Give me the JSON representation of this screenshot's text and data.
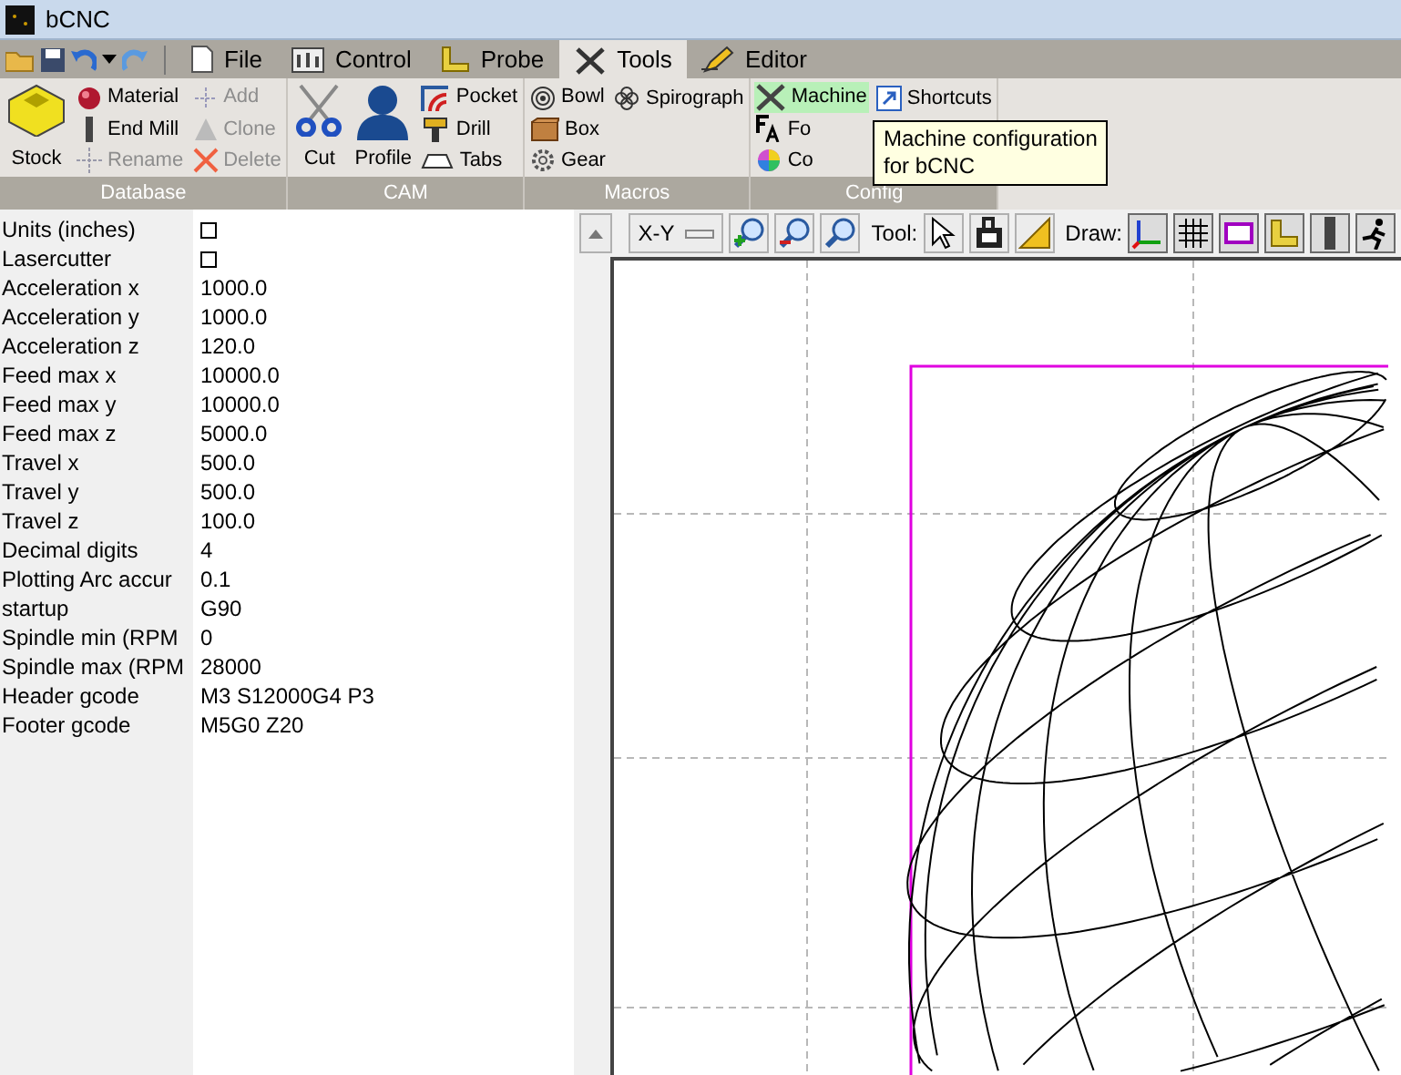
{
  "window": {
    "title": "bCNC"
  },
  "tabs": [
    {
      "label": "File",
      "selected": false
    },
    {
      "label": "Control",
      "selected": false
    },
    {
      "label": "Probe",
      "selected": false
    },
    {
      "label": "Tools",
      "selected": true
    },
    {
      "label": "Editor",
      "selected": false
    }
  ],
  "ribbon": [
    {
      "label": "Database",
      "columns": [
        [
          {
            "label": "Stock",
            "kind": "large",
            "disabled": false,
            "hovered": false
          }
        ],
        [
          {
            "label": "Material",
            "kind": "small",
            "disabled": false,
            "hovered": false
          },
          {
            "label": "End Mill",
            "kind": "small",
            "disabled": false,
            "hovered": false
          },
          {
            "label": "Rename",
            "kind": "small",
            "disabled": true,
            "hovered": false
          }
        ],
        [
          {
            "label": "Add",
            "kind": "small",
            "disabled": true,
            "hovered": false
          },
          {
            "label": "Clone",
            "kind": "small",
            "disabled": true,
            "hovered": false
          },
          {
            "label": "Delete",
            "kind": "small",
            "disabled": true,
            "hovered": false
          }
        ]
      ]
    },
    {
      "label": "CAM",
      "columns": [
        [
          {
            "label": "Cut",
            "kind": "large",
            "disabled": false,
            "hovered": false
          }
        ],
        [
          {
            "label": "Profile",
            "kind": "large",
            "disabled": false,
            "hovered": false
          }
        ],
        [
          {
            "label": "Pocket",
            "kind": "small",
            "disabled": false,
            "hovered": false
          },
          {
            "label": "Drill",
            "kind": "small",
            "disabled": false,
            "hovered": false
          },
          {
            "label": "Tabs",
            "kind": "small",
            "disabled": false,
            "hovered": false
          }
        ]
      ]
    },
    {
      "label": "Macros",
      "columns": [
        [
          {
            "label": "Bowl",
            "kind": "small",
            "disabled": false,
            "hovered": false
          },
          {
            "label": "Box",
            "kind": "small",
            "disabled": false,
            "hovered": false
          },
          {
            "label": "Gear",
            "kind": "small",
            "disabled": false,
            "hovered": false
          }
        ],
        [
          {
            "label": "Spirograph",
            "kind": "small",
            "disabled": false,
            "hovered": false
          }
        ]
      ]
    },
    {
      "label": "Config",
      "columns": [
        [
          {
            "label": "Machine",
            "kind": "small",
            "disabled": false,
            "hovered": true
          },
          {
            "label": "Fo",
            "kind": "small",
            "disabled": false,
            "hovered": false
          },
          {
            "label": "Co",
            "kind": "small",
            "disabled": false,
            "hovered": false
          }
        ],
        [
          {
            "label": "Shortcuts",
            "kind": "small",
            "disabled": false,
            "hovered": false
          }
        ]
      ]
    }
  ],
  "tooltip": {
    "lines": [
      "Machine configuration",
      "for bCNC"
    ]
  },
  "properties": [
    {
      "label": "Units (inches)",
      "kind": "checkbox",
      "checked": false
    },
    {
      "label": "Lasercutter",
      "kind": "checkbox",
      "checked": false
    },
    {
      "label": "Acceleration x",
      "kind": "text",
      "value": "1000.0"
    },
    {
      "label": "Acceleration y",
      "kind": "text",
      "value": "1000.0"
    },
    {
      "label": "Acceleration z",
      "kind": "text",
      "value": "120.0"
    },
    {
      "label": "Feed max x",
      "kind": "text",
      "value": "10000.0"
    },
    {
      "label": "Feed max y",
      "kind": "text",
      "value": "10000.0"
    },
    {
      "label": "Feed max z",
      "kind": "text",
      "value": "5000.0"
    },
    {
      "label": "Travel x",
      "kind": "text",
      "value": "500.0"
    },
    {
      "label": "Travel y",
      "kind": "text",
      "value": "500.0"
    },
    {
      "label": "Travel z",
      "kind": "text",
      "value": "100.0"
    },
    {
      "label": "Decimal digits",
      "kind": "text",
      "value": "4"
    },
    {
      "label": "Plotting Arc accur",
      "kind": "text",
      "value": "0.1"
    },
    {
      "label": "startup",
      "kind": "text",
      "value": "G90"
    },
    {
      "label": "Spindle min (RPM",
      "kind": "text",
      "value": "0"
    },
    {
      "label": "Spindle max (RPM",
      "kind": "text",
      "value": "28000"
    },
    {
      "label": "Header gcode",
      "kind": "text",
      "value": "M3 S12000G4 P3"
    },
    {
      "label": "Footer gcode",
      "kind": "text",
      "value": "M5G0 Z20"
    }
  ],
  "toolbar": {
    "view": "X-Y",
    "tool_label": "Tool:",
    "draw_label": "Draw:",
    "draw_toggles": [
      {
        "on": true
      },
      {
        "on": true
      },
      {
        "on": true
      },
      {
        "on": true
      },
      {
        "on": true
      },
      {
        "on": true
      }
    ]
  }
}
